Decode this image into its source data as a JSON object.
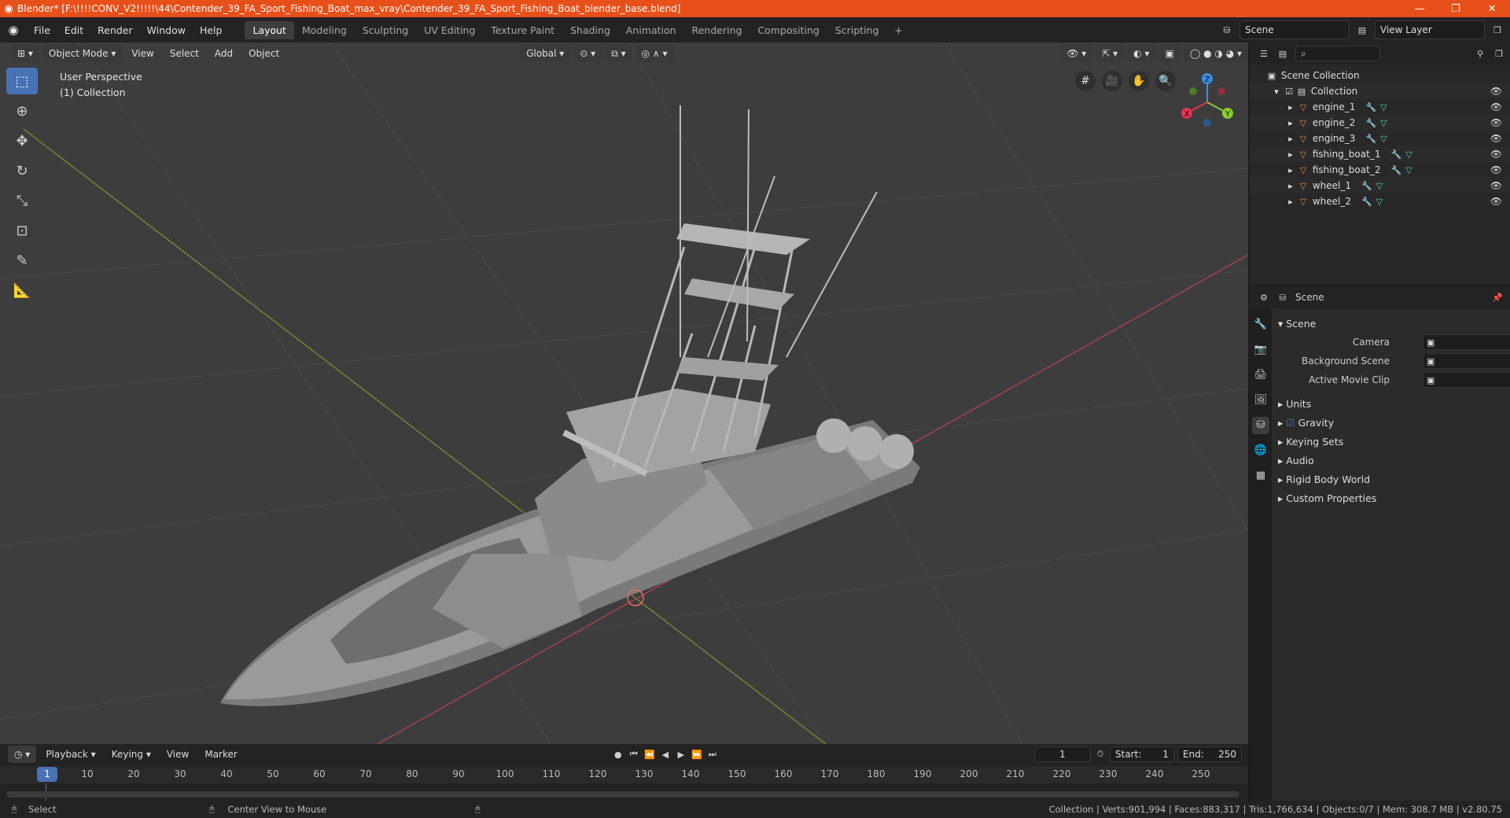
{
  "window": {
    "title": "Blender* [F:\\!!!!CONV_V2!!!!!\\44\\Contender_39_FA_Sport_Fishing_Boat_max_vray\\Contender_39_FA_Sport_Fishing_Boat_blender_base.blend]",
    "minimize": "—",
    "restore": "❐",
    "close": "✕"
  },
  "menu": [
    "File",
    "Edit",
    "Render",
    "Window",
    "Help"
  ],
  "workspaces": [
    "Layout",
    "Modeling",
    "Sculpting",
    "UV Editing",
    "Texture Paint",
    "Shading",
    "Animation",
    "Rendering",
    "Compositing",
    "Scripting"
  ],
  "workspace_add": "+",
  "scene_field": "Scene",
  "view_layer_field": "View Layer",
  "viewport": {
    "mode": "Object Mode",
    "menus": [
      "View",
      "Select",
      "Add",
      "Object"
    ],
    "transform": "Global",
    "perspective": "User Perspective",
    "collection": "(1) Collection",
    "axes": {
      "x": "X",
      "y": "Y",
      "z": "Z"
    }
  },
  "outliner": {
    "search_placeholder": "",
    "root": "Scene Collection",
    "collection": "Collection",
    "objects": [
      "engine_1",
      "engine_2",
      "engine_3",
      "fishing_boat_1",
      "fishing_boat_2",
      "wheel_1",
      "wheel_2"
    ]
  },
  "properties": {
    "header": "Scene",
    "panel": "Scene",
    "fields": [
      {
        "label": "Camera"
      },
      {
        "label": "Background Scene"
      },
      {
        "label": "Active Movie Clip"
      }
    ],
    "sections": [
      "Units",
      "Gravity",
      "Keying Sets",
      "Audio",
      "Rigid Body World",
      "Custom Properties"
    ]
  },
  "timeline": {
    "menus": [
      "Playback",
      "Keying",
      "View",
      "Marker"
    ],
    "current_frame": "1",
    "start_label": "Start:",
    "start": "1",
    "end_label": "End:",
    "end": "250",
    "playhead_frame": "1",
    "ticks": [
      "10",
      "20",
      "30",
      "40",
      "50",
      "60",
      "70",
      "80",
      "90",
      "100",
      "110",
      "120",
      "130",
      "140",
      "150",
      "160",
      "170",
      "180",
      "190",
      "200",
      "210",
      "220",
      "230",
      "240",
      "250"
    ]
  },
  "status": {
    "left_action": "Select",
    "middle_action": "Center View to Mouse",
    "stats": "Collection | Verts:901,994 | Faces:883,317 | Tris:1,766,634 | Objects:0/7 | Mem: 308.7 MB | v2.80.75"
  },
  "colors": {
    "title_bar": "#e8501a",
    "accent": "#4772b3",
    "object_icon": "#e8873a",
    "modifier_icon": "#5aa0e8",
    "mesh_icon": "#4fd8a0",
    "axis_x": "#e8334b",
    "axis_y": "#8acb2a",
    "axis_z": "#3a8fe8"
  }
}
